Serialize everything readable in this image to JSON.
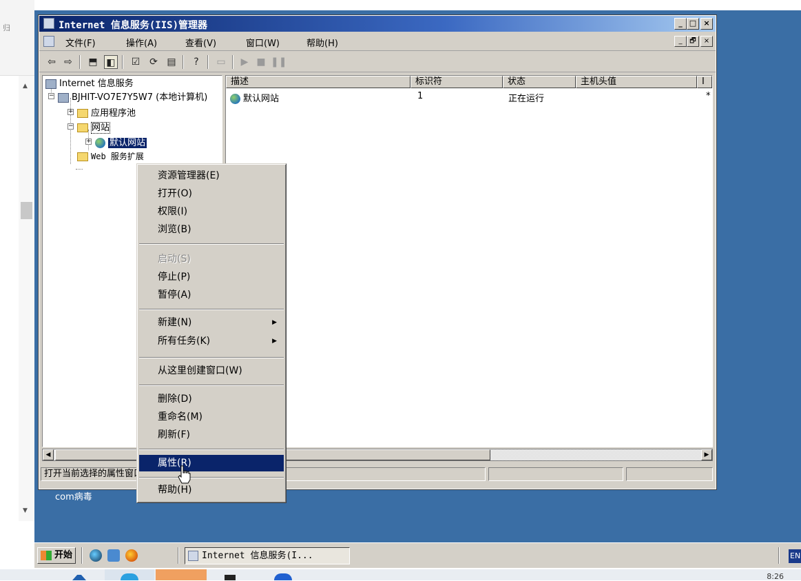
{
  "host": {
    "left_peek_text": "归",
    "clock": "8:26"
  },
  "window": {
    "title": "Internet 信息服务(IIS)管理器",
    "caption_buttons": [
      "_",
      "□",
      "×"
    ]
  },
  "menubar": {
    "items": [
      "文件(F)",
      "操作(A)",
      "查看(V)",
      "窗口(W)",
      "帮助(H)"
    ],
    "mdi_buttons": [
      "_",
      "🗗",
      "×"
    ]
  },
  "toolbar": {
    "icons": [
      "back-icon",
      "forward-icon",
      "up-folder-icon",
      "show-tree-icon",
      "properties-icon",
      "refresh-icon",
      "export-icon",
      "help-icon",
      "computer-icon",
      "play-icon",
      "stop-icon",
      "pause-icon"
    ]
  },
  "tree": {
    "root": "Internet 信息服务",
    "server": "BJHIT-VO7E7Y5W7 (本地计算机)",
    "app_pools": "应用程序池",
    "websites": "网站",
    "default_site": "默认网站",
    "web_ext": "Web 服务扩展"
  },
  "list": {
    "columns": [
      "描述",
      "标识符",
      "状态",
      "主机头值",
      "I"
    ],
    "rows": [
      {
        "desc": "默认网站",
        "id": "1",
        "status": "正在运行",
        "host": "",
        "ip": "*"
      }
    ]
  },
  "statusbar": {
    "text": "打开当前选择的属性窗口。"
  },
  "context_menu": {
    "items": [
      {
        "label": "资源管理器(E)",
        "disabled": false,
        "submenu": false
      },
      {
        "label": "打开(O)",
        "disabled": false,
        "submenu": false
      },
      {
        "label": "权限(I)",
        "disabled": false,
        "submenu": false
      },
      {
        "label": "浏览(B)",
        "disabled": false,
        "submenu": false
      },
      {
        "label": "启动(S)",
        "disabled": true,
        "submenu": false
      },
      {
        "label": "停止(P)",
        "disabled": false,
        "submenu": false
      },
      {
        "label": "暂停(A)",
        "disabled": false,
        "submenu": false
      },
      {
        "label": "新建(N)",
        "disabled": false,
        "submenu": true
      },
      {
        "label": "所有任务(K)",
        "disabled": false,
        "submenu": true
      },
      {
        "label": "从这里创建窗口(W)",
        "disabled": false,
        "submenu": false
      },
      {
        "label": "删除(D)",
        "disabled": false,
        "submenu": false
      },
      {
        "label": "重命名(M)",
        "disabled": false,
        "submenu": false
      },
      {
        "label": "刷新(F)",
        "disabled": false,
        "submenu": false
      },
      {
        "label": "属性(R)",
        "disabled": false,
        "submenu": false,
        "highlighted": true
      },
      {
        "label": "帮助(H)",
        "disabled": false,
        "submenu": false
      }
    ]
  },
  "desktop": {
    "label": "com病毒"
  },
  "taskbar": {
    "start_label": "开始",
    "task_button": "Internet 信息服务(I...",
    "lang": "EN"
  },
  "colors": {
    "desktop": "#3a6ea5",
    "title_active": "#0a246a",
    "chrome": "#d4d0c8",
    "highlight": "#0a246a"
  }
}
